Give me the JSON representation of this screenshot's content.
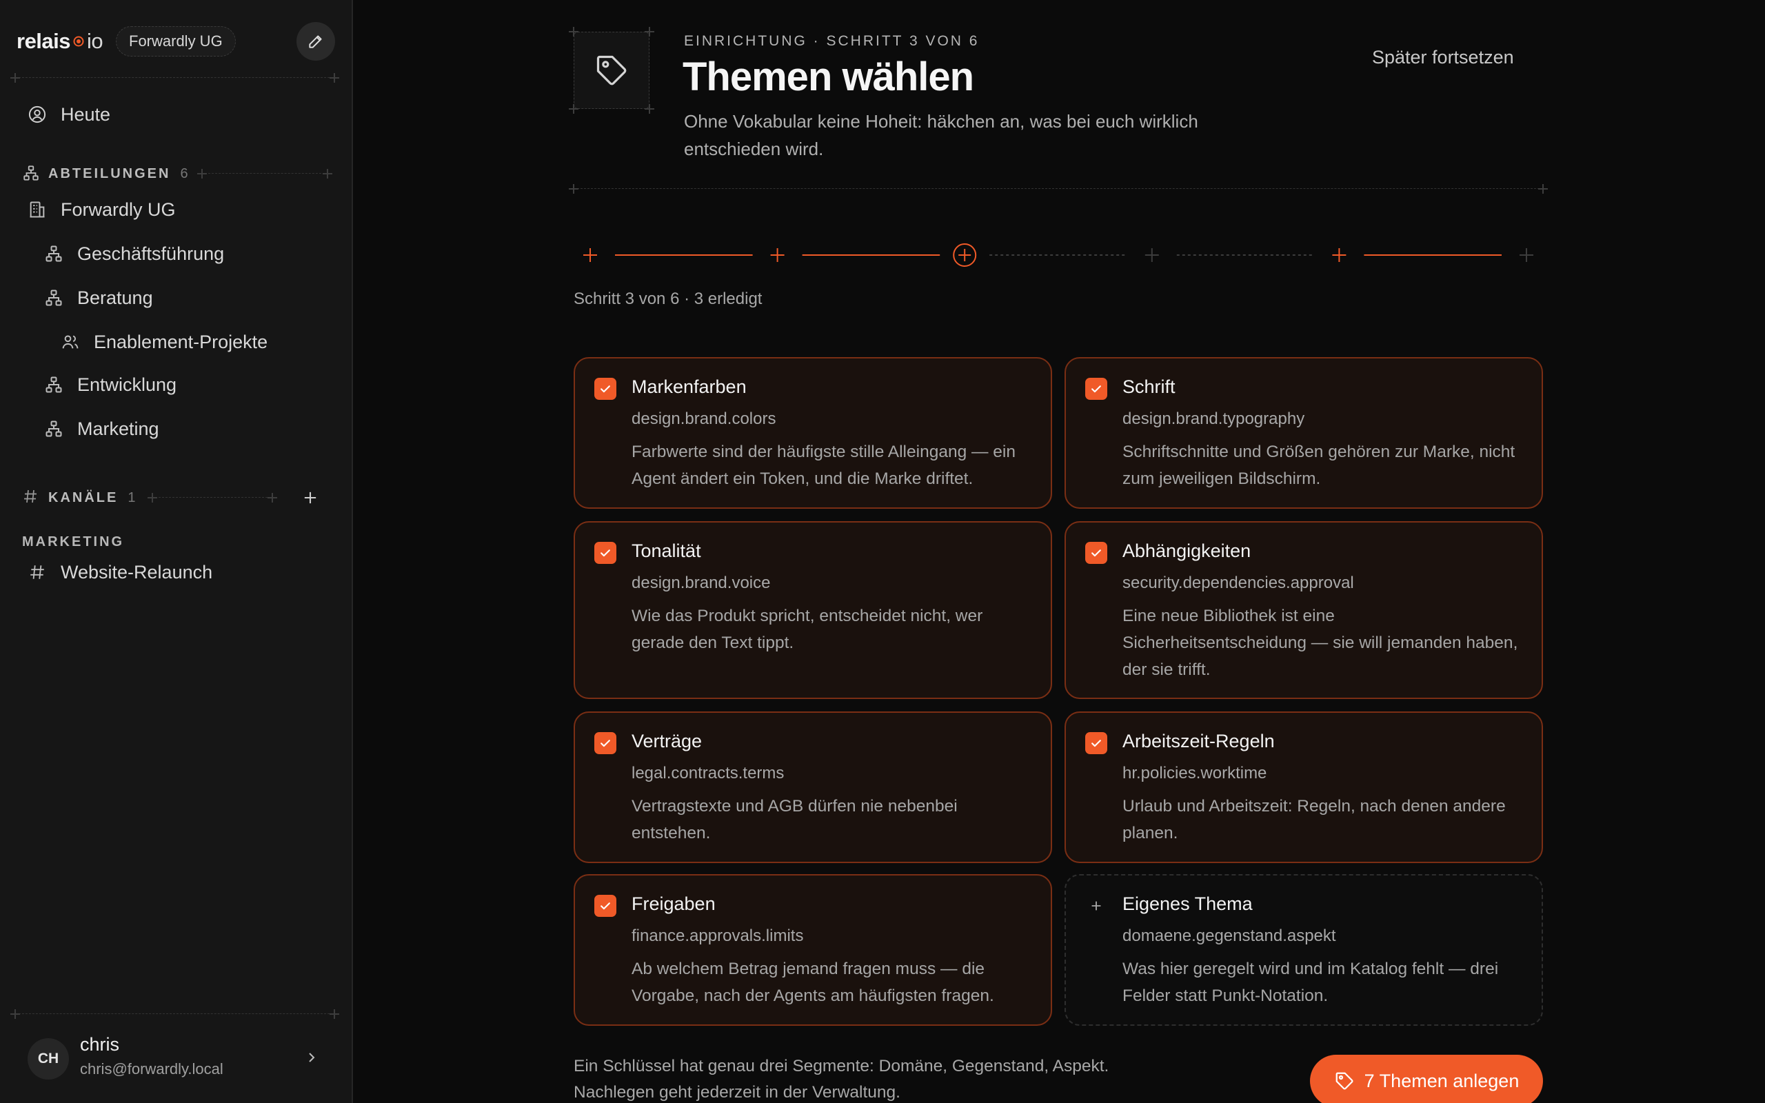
{
  "sidebar": {
    "logo": {
      "part1": "relais",
      "part2": "io"
    },
    "org_badge": "Forwardly UG",
    "nav_today": "Heute",
    "departments": {
      "title": "ABTEILUNGEN",
      "count": "6",
      "items": [
        {
          "label": "Forwardly UG",
          "icon": "building-icon"
        },
        {
          "label": "Geschäftsführung",
          "icon": "org-chart-icon"
        },
        {
          "label": "Beratung",
          "icon": "org-chart-icon"
        },
        {
          "label": "Enablement-Projekte",
          "icon": "people-icon"
        },
        {
          "label": "Entwicklung",
          "icon": "org-chart-icon"
        },
        {
          "label": "Marketing",
          "icon": "org-chart-icon"
        }
      ]
    },
    "channels": {
      "title": "KANÄLE",
      "count": "1",
      "group_label": "MARKETING",
      "items": [
        {
          "label": "Website-Relaunch"
        }
      ]
    },
    "user": {
      "initials": "CH",
      "name": "chris",
      "email": "chris@forwardly.local"
    }
  },
  "header": {
    "eyebrow": "EINRICHTUNG · SCHRITT 3 VON 6",
    "title": "Themen wählen",
    "subtitle": "Ohne Vokabular keine Hoheit: häkchen an, was bei euch wirklich entschieden wird.",
    "later_link": "Später fortsetzen"
  },
  "stepper": {
    "total_steps": 6,
    "current_step": 3,
    "completed_steps": [
      1,
      2,
      5
    ],
    "status_text": "Schritt 3 von 6 · 3 erledigt"
  },
  "topics": [
    {
      "title": "Markenfarben",
      "key": "design.brand.colors",
      "desc": "Farbwerte sind der häufigste stille Alleingang — ein Agent ändert ein Token, und die Marke driftet.",
      "checked": true
    },
    {
      "title": "Schrift",
      "key": "design.brand.typography",
      "desc": "Schriftschnitte und Größen gehören zur Marke, nicht zum jeweiligen Bildschirm.",
      "checked": true
    },
    {
      "title": "Tonalität",
      "key": "design.brand.voice",
      "desc": "Wie das Produkt spricht, entscheidet nicht, wer gerade den Text tippt.",
      "checked": true
    },
    {
      "title": "Abhängigkeiten",
      "key": "security.dependencies.approval",
      "desc": "Eine neue Bibliothek ist eine Sicherheitsentscheidung — sie will jemanden haben, der sie trifft.",
      "checked": true
    },
    {
      "title": "Verträge",
      "key": "legal.contracts.terms",
      "desc": "Vertragstexte und AGB dürfen nie nebenbei entstehen.",
      "checked": true
    },
    {
      "title": "Arbeitszeit-Regeln",
      "key": "hr.policies.worktime",
      "desc": "Urlaub und Arbeitszeit: Regeln, nach denen andere planen.",
      "checked": true
    },
    {
      "title": "Freigaben",
      "key": "finance.approvals.limits",
      "desc": "Ab welchem Betrag jemand fragen muss — die Vorgabe, nach der Agents am häufigsten fragen.",
      "checked": true
    },
    {
      "title": "Eigenes Thema",
      "key": "domaene.gegenstand.aspekt",
      "desc": "Was hier geregelt wird und im Katalog fehlt — drei Felder statt Punkt-Notation.",
      "checked": false,
      "custom": true
    }
  ],
  "footer": {
    "note": "Ein Schlüssel hat genau drei Segmente: Domäne, Gegenstand, Aspekt. Nachlegen geht jederzeit in der Verwaltung.",
    "create_button": "7 Themen anlegen"
  },
  "colors": {
    "accent": "#f05a28",
    "card_border": "#7a2e14",
    "card_bg": "#1a110d",
    "background": "#0b0b0b",
    "sidebar_bg": "#161616"
  }
}
